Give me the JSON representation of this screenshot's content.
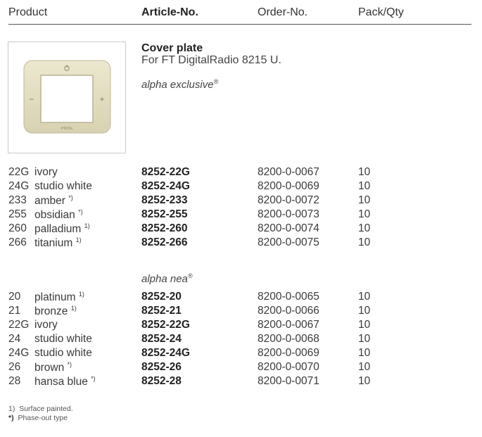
{
  "header": {
    "product": "Product",
    "article": "Article-No.",
    "order": "Order-No.",
    "pack": "Pack/Qty"
  },
  "product": {
    "title": "Cover plate",
    "subtitle": "For FT DigitalRadio 8215 U.",
    "image": {
      "icon": "cover-plate-photo",
      "label": "PROG",
      "plate_color": "#e7e2c6",
      "frame_color": "#c9c9c9"
    }
  },
  "lines": [
    {
      "name": "alpha exclusive",
      "mark": "®",
      "rows": [
        {
          "code": "22G",
          "name": "ivory",
          "note": "",
          "article": "8252-22G",
          "order": "8200-0-0067",
          "pack": "10"
        },
        {
          "code": "24G",
          "name": "studio white",
          "note": "",
          "article": "8252-24G",
          "order": "8200-0-0069",
          "pack": "10"
        },
        {
          "code": "233",
          "name": "amber",
          "note": "*)",
          "article": "8252-233",
          "order": "8200-0-0072",
          "pack": "10"
        },
        {
          "code": "255",
          "name": "obsidian",
          "note": "*)",
          "article": "8252-255",
          "order": "8200-0-0073",
          "pack": "10"
        },
        {
          "code": "260",
          "name": "palladium",
          "note": "1)",
          "article": "8252-260",
          "order": "8200-0-0074",
          "pack": "10"
        },
        {
          "code": "266",
          "name": "titanium",
          "note": "1)",
          "article": "8252-266",
          "order": "8200-0-0075",
          "pack": "10"
        }
      ]
    },
    {
      "name": "alpha nea",
      "mark": "®",
      "rows": [
        {
          "code": "20",
          "name": "platinum",
          "note": "1)",
          "article": "8252-20",
          "order": "8200-0-0065",
          "pack": "10"
        },
        {
          "code": "21",
          "name": "bronze",
          "note": "1)",
          "article": "8252-21",
          "order": "8200-0-0066",
          "pack": "10"
        },
        {
          "code": "22G",
          "name": "ivory",
          "note": "",
          "article": "8252-22G",
          "order": "8200-0-0067",
          "pack": "10"
        },
        {
          "code": "24",
          "name": "studio white",
          "note": "",
          "article": "8252-24",
          "order": "8200-0-0068",
          "pack": "10"
        },
        {
          "code": "24G",
          "name": "studio white",
          "note": "",
          "article": "8252-24G",
          "order": "8200-0-0069",
          "pack": "10"
        },
        {
          "code": "26",
          "name": "brown",
          "note": "*)",
          "article": "8252-26",
          "order": "8200-0-0070",
          "pack": "10"
        },
        {
          "code": "28",
          "name": "hansa blue",
          "note": "*)",
          "article": "8252-28",
          "order": "8200-0-0071",
          "pack": "10"
        }
      ]
    }
  ],
  "footnotes": [
    {
      "marker": "1)",
      "text": "Surface painted."
    },
    {
      "marker": "*)",
      "text": "Phase-out type"
    }
  ]
}
